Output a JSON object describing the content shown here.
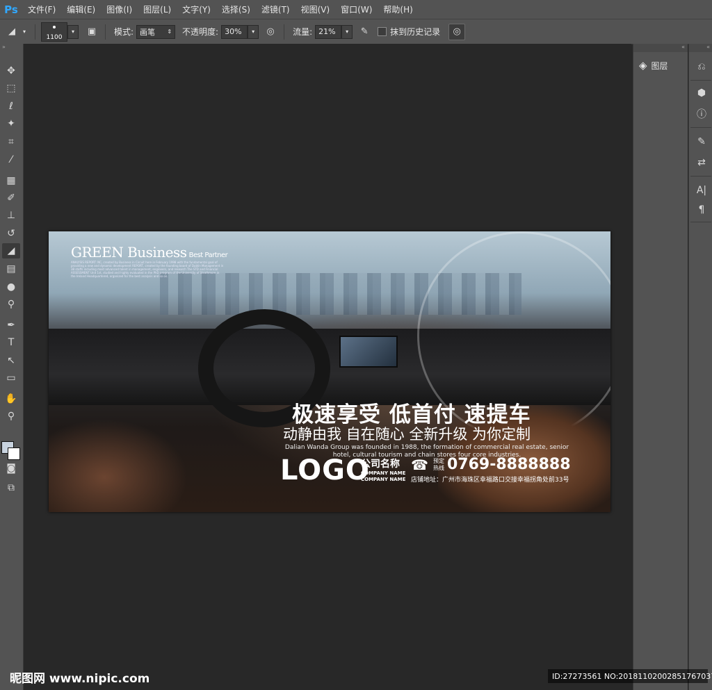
{
  "app": {
    "logo": "Ps"
  },
  "menu": [
    "文件(F)",
    "编辑(E)",
    "图像(I)",
    "图层(L)",
    "文字(Y)",
    "选择(S)",
    "滤镜(T)",
    "视图(V)",
    "窗口(W)",
    "帮助(H)"
  ],
  "options": {
    "brush_size": "1100",
    "mode_label": "模式:",
    "mode_value": "画笔",
    "opacity_label": "不透明度:",
    "opacity_value": "30%",
    "flow_label": "流量:",
    "flow_value": "21%",
    "history_label": "抹到历史记录"
  },
  "panels": {
    "layers_label": "图层"
  },
  "document": {
    "brand": "GREEN Business",
    "brand_sub": "Best Partner",
    "brand_body": "ANALYSIS REPORT: NC, created by Business in Circuit here in February 1998 with the fundamental goal of providing a new and dynamic development REPORT, created by the founding board of Dublin Management in 38 staffs including most advanced talent in management, engineers, and research The STD and Financial ASSESSMENT Unit 1st, studied and highly evaluated in the PhD program of the University of Strathmore in the Ireland Headquartered, organized for the best analysis and so on.",
    "headline": "极速享受 低首付 速提车",
    "subline": "动静由我 自在随心 全新升级 为你定制",
    "english": "Dalian Wanda Group was founded in 1988, the formation of commercial real estate, senior hotel, cultural tourism and chain stores four core industries.",
    "logo": "LOGO",
    "company_name": "公司名称",
    "company_en_1": "COMPANY NAME",
    "company_en_2": "COMPANY NAME",
    "hotline_1": "预定",
    "hotline_2": "热线",
    "phone": "0769-8888888",
    "address": "店铺地址：广州市海珠区幸福路口交接幸福拐角处前33号"
  },
  "watermark": {
    "left": "昵图网 www.nipic.com",
    "right": "ID:27273561 NO:20181102002851767037"
  },
  "colors": {
    "foreground": "#c8d3df",
    "background": "#ffffff",
    "ps_blue": "#31a8ff"
  }
}
